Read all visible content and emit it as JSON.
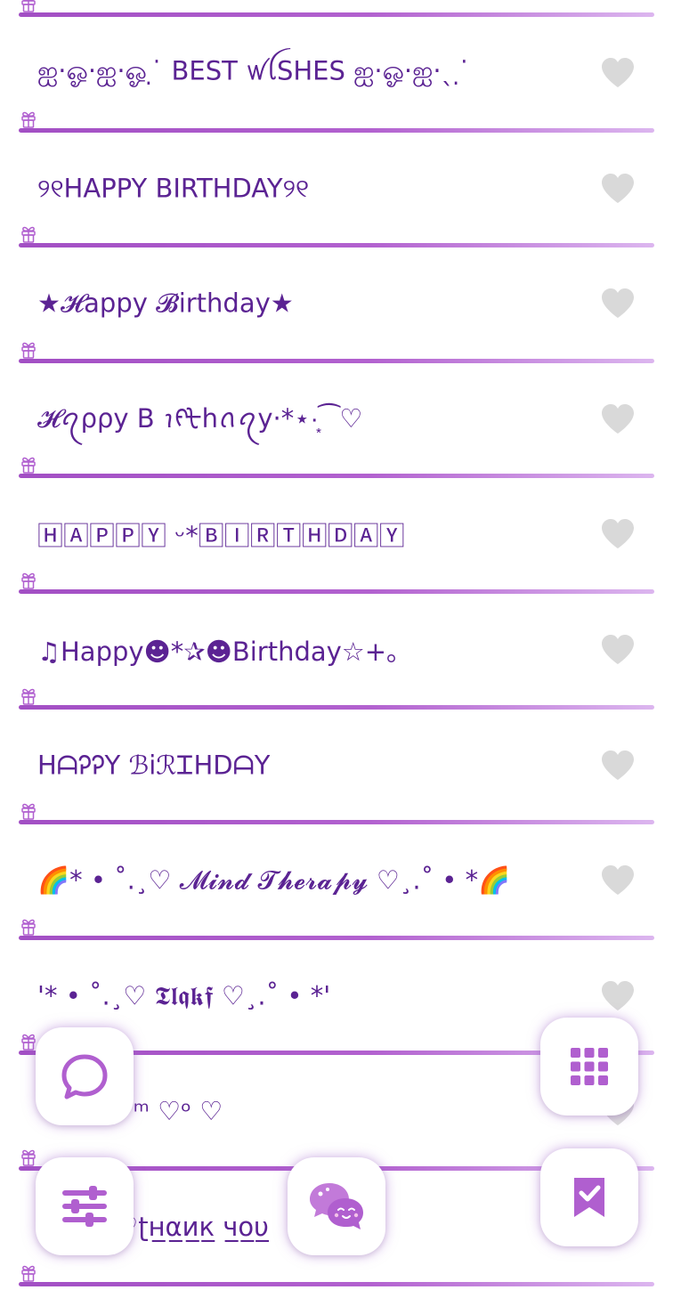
{
  "colors": {
    "text": "#5b2393",
    "accent": "#b05fcf",
    "heart": "#d9d9d9"
  },
  "rows": [
    {
      "text": "ஐ·ஓ·ஐ·ஓ ̣ ̇ BEST ꪝꪶSHES  ஐ·ஓ·ஐ·ˎ ̣ ̇"
    },
    {
      "text": "୨୧HAPPY BIRTHDAY୨୧"
    },
    {
      "text": "★𝓗appy 𝓑irthday★"
    },
    {
      "text": "𝓗ꪖρρy B ꪱᠻᡶhꪒꪖy·*⋆·͙⁀♡"
    },
    {
      "text": "🄷🄰🄿🄿🅈 ᵕ*🄱🄸🅁🅃🄷🄳🄰🅈"
    },
    {
      "text": "♫Happy☻*✰☻Birthday☆+｡"
    },
    {
      "text": "HᗩᎮᎮY ℬiℛᏆHDᗩY"
    },
    {
      "text": "🌈* • ˚.¸♡ 𝓜𝓲𝓷𝓭 𝓣𝓱𝓮𝓻𝓪𝓹𝔂 ♡¸.˚ • *🌈"
    },
    {
      "text": "'* • ˚.¸♡ 𝕿𝖑𝖖𝖐𝖋 ♡¸.˚ • *'"
    },
    {
      "text": "♡ᵃ ♡   ♡ᵐ ♡ᵒ ♡"
    },
    {
      "text": "♡♡ ♡♡ʈ̲н̲α̲и̲к̲ ч̲о̲υ̲"
    }
  ],
  "icons": {
    "heart": "heart-icon",
    "gift": "gift-icon",
    "chat": "chat-bubble-icon",
    "grid": "grid-icon",
    "filters": "sliders-icon",
    "messages": "kawaii-chat-icon",
    "bookmark": "bookmark-check-icon"
  }
}
